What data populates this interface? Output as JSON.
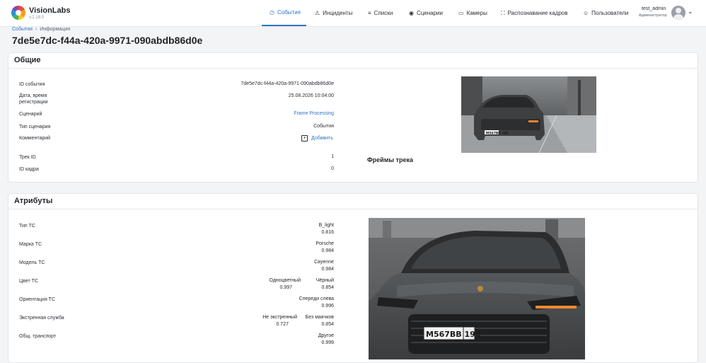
{
  "app": {
    "name": "VisionLabs",
    "version": "v.2.18.0"
  },
  "nav": [
    {
      "label": "События",
      "icon": "clock-icon",
      "active": true
    },
    {
      "label": "Инциденты",
      "icon": "warning-icon"
    },
    {
      "label": "Списки",
      "icon": "list-icon"
    },
    {
      "label": "Сценарии",
      "icon": "eye-icon"
    },
    {
      "label": "Камеры",
      "icon": "camera-icon"
    },
    {
      "label": "Распознавание кадров",
      "icon": "frame-icon"
    },
    {
      "label": "Пользователи",
      "icon": "users-icon"
    }
  ],
  "user": {
    "name": "test_admin",
    "role": "Администратор"
  },
  "breadcrumb": {
    "root": "События",
    "separator": "›",
    "current": "Информация"
  },
  "page_title": "7de5e7dc-f44a-420a-9971-090abdb86d0e",
  "general": {
    "title": "Общие",
    "fields": [
      {
        "label": "ID события",
        "value": "7de5e7dc-f44a-420a-9971-090abdb86d0e"
      },
      {
        "label": "Дата, время регистрации",
        "value": "25.08.2026 10:04:00"
      },
      {
        "label": "Сценарий",
        "value": "Frame Processing"
      },
      {
        "label": "Тип сценария",
        "value": "События"
      },
      {
        "label": "Комментарий",
        "value": "Добавить"
      },
      {
        "label": "Трек ID",
        "value": "1"
      },
      {
        "label": "ID кадра",
        "value": "0"
      }
    ],
    "track_frames_title": "Фреймы трека",
    "plate_text": "М567ВВ 196"
  },
  "attributes": {
    "title": "Атрибуты",
    "rows": [
      {
        "label": "Тип ТС",
        "values": [
          {
            "name": "B_light",
            "score": "0.816"
          }
        ]
      },
      {
        "label": "Марка ТС",
        "values": [
          {
            "name": "Porsche",
            "score": "0.984"
          }
        ]
      },
      {
        "label": "Модель ТС",
        "values": [
          {
            "name": "Cayenne",
            "score": "0.984"
          }
        ]
      },
      {
        "label": "Цвет ТС",
        "values": [
          {
            "name": "Одноцветный",
            "score": "0.997"
          },
          {
            "name": "Чёрный",
            "score": "0.854"
          }
        ]
      },
      {
        "label": "Ориентация ТС",
        "values": [
          {
            "name": "Спереди слева",
            "score": "0.996"
          }
        ]
      },
      {
        "label": "Экстренная служба",
        "values": [
          {
            "name": "Не экстренный",
            "score": "0.727"
          },
          {
            "name": "Без маячков",
            "score": "0.854"
          }
        ]
      },
      {
        "label": "Общ. транспорт",
        "values": [
          {
            "name": "Другое",
            "score": "0.999"
          }
        ]
      }
    ],
    "plate_text": "М567ВВ 196"
  }
}
